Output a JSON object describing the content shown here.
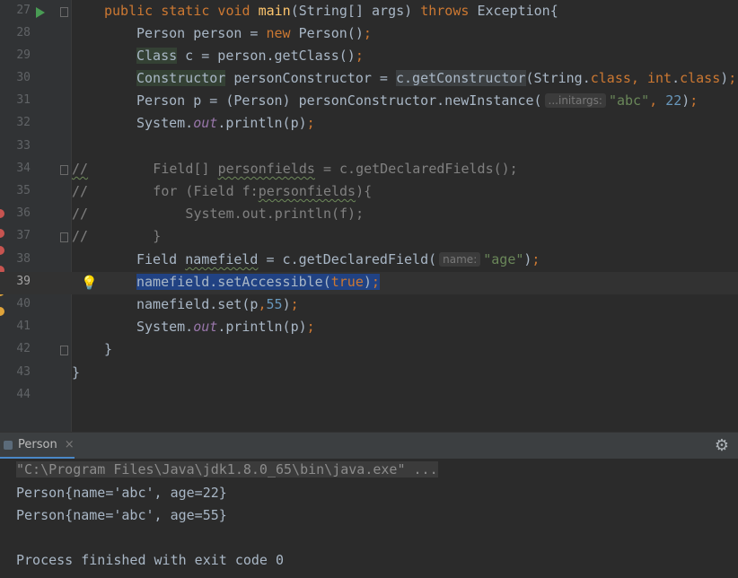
{
  "editor": {
    "lines": [
      {
        "num": "27"
      },
      {
        "num": "28"
      },
      {
        "num": "29"
      },
      {
        "num": "30"
      },
      {
        "num": "31"
      },
      {
        "num": "32"
      },
      {
        "num": "33"
      },
      {
        "num": "34"
      },
      {
        "num": "35"
      },
      {
        "num": "36"
      },
      {
        "num": "37"
      },
      {
        "num": "38"
      },
      {
        "num": "39"
      },
      {
        "num": "40"
      },
      {
        "num": "41"
      },
      {
        "num": "42"
      },
      {
        "num": "43"
      },
      {
        "num": "44"
      }
    ],
    "current_line": "39",
    "hints": {
      "initargs": "...initargs:",
      "name": "name:"
    },
    "colors": {
      "keyword": "#cc7832",
      "string": "#6a8759",
      "number": "#6897bb",
      "static": "#9876aa",
      "comment": "#808080",
      "selection": "#214283"
    }
  },
  "run_panel": {
    "tab_label": "Person",
    "close_icon": "×",
    "settings_icon": "gear-icon",
    "output": [
      "\"C:\\Program Files\\Java\\jdk1.8.0_65\\bin\\java.exe\" ...",
      "Person{name='abc', age=22}",
      "Person{name='abc', age=55}",
      "",
      "Process finished with exit code 0"
    ]
  }
}
